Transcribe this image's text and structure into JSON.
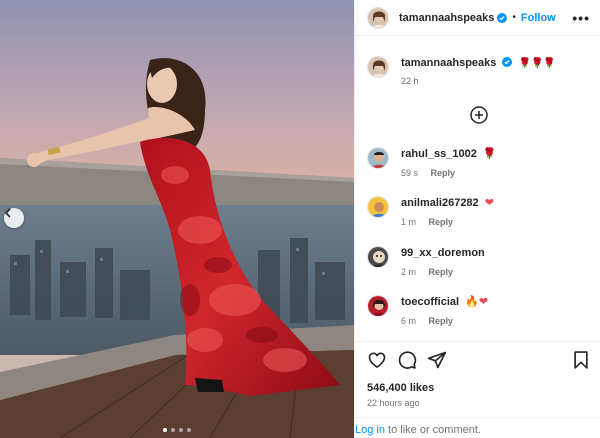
{
  "post": {
    "image_alt": "Woman in a flowing red rose-print gown leaning on a rooftop ledge at sunset over a city",
    "carousel_dots": 4,
    "active_dot": 0
  },
  "header": {
    "username": "tamannaahspeaks",
    "separator": "•",
    "follow_label": "Follow",
    "more_icon": "more-horizontal-icon"
  },
  "caption": {
    "username": "tamannaahspeaks",
    "emojis": "🌹🌹🌹",
    "time": "22 h"
  },
  "comments": [
    {
      "username": "rahul_ss_1002",
      "text": "🌹",
      "time": "59 s",
      "reply_label": "Reply"
    },
    {
      "username": "anilmali267282",
      "text": "❤",
      "time": "1 m",
      "reply_label": "Reply"
    },
    {
      "username": "99_xx_doremon",
      "text": "",
      "time": "2 m",
      "reply_label": "Reply"
    },
    {
      "username": "toecofficial",
      "text": "🔥❤",
      "time": "6 m",
      "reply_label": "Reply"
    }
  ],
  "actions": {
    "like_icon": "heart-icon",
    "comment_icon": "comment-icon",
    "share_icon": "share-icon",
    "save_icon": "bookmark-icon"
  },
  "likes": "546,400 likes",
  "posted": "22 hours ago",
  "login": {
    "link": "Log in",
    "rest": " to like or comment."
  },
  "colors": {
    "accent": "#0095f6",
    "text": "#262626",
    "muted": "#737373",
    "heart": "#ed4956"
  }
}
